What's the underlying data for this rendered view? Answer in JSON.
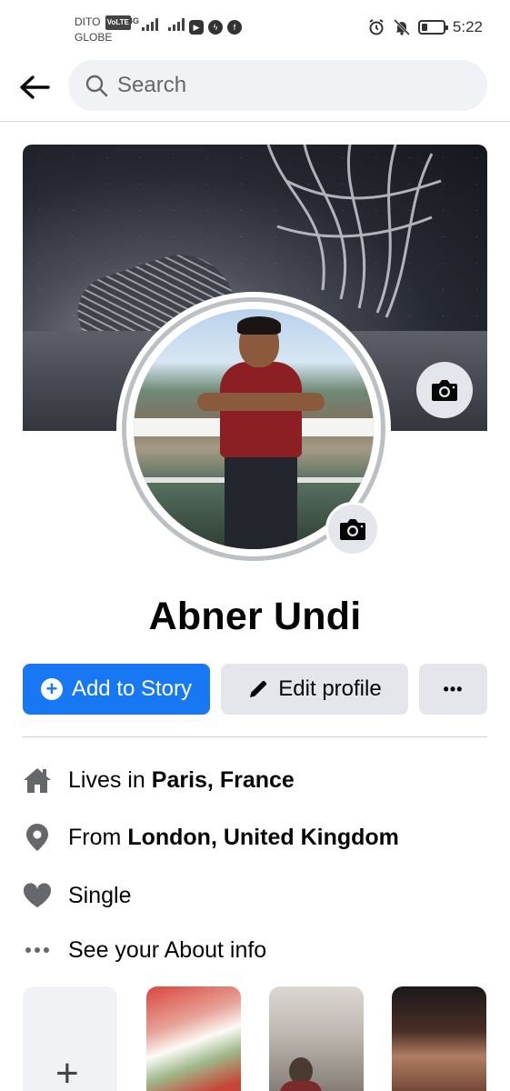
{
  "status_bar": {
    "carrier_top": "DITO",
    "volte": "VoLTE",
    "carrier_bottom": "GLOBE",
    "network": "4G",
    "time": "5:22"
  },
  "header": {
    "search_placeholder": "Search"
  },
  "profile": {
    "name": "Abner Undi"
  },
  "actions": {
    "add_story": "Add to Story",
    "edit_profile": "Edit profile",
    "more": "•••"
  },
  "intro": {
    "lives_prefix": "Lives in",
    "lives_value": "Paris, France",
    "from_prefix": "From",
    "from_value": "London, United Kingdom",
    "relationship": "Single",
    "about": "See your About info"
  },
  "photos": {
    "add_symbol": "+"
  },
  "colors": {
    "primary": "#1877f2",
    "button_gray": "#e4e6eb",
    "icon_gray": "#65676b"
  }
}
